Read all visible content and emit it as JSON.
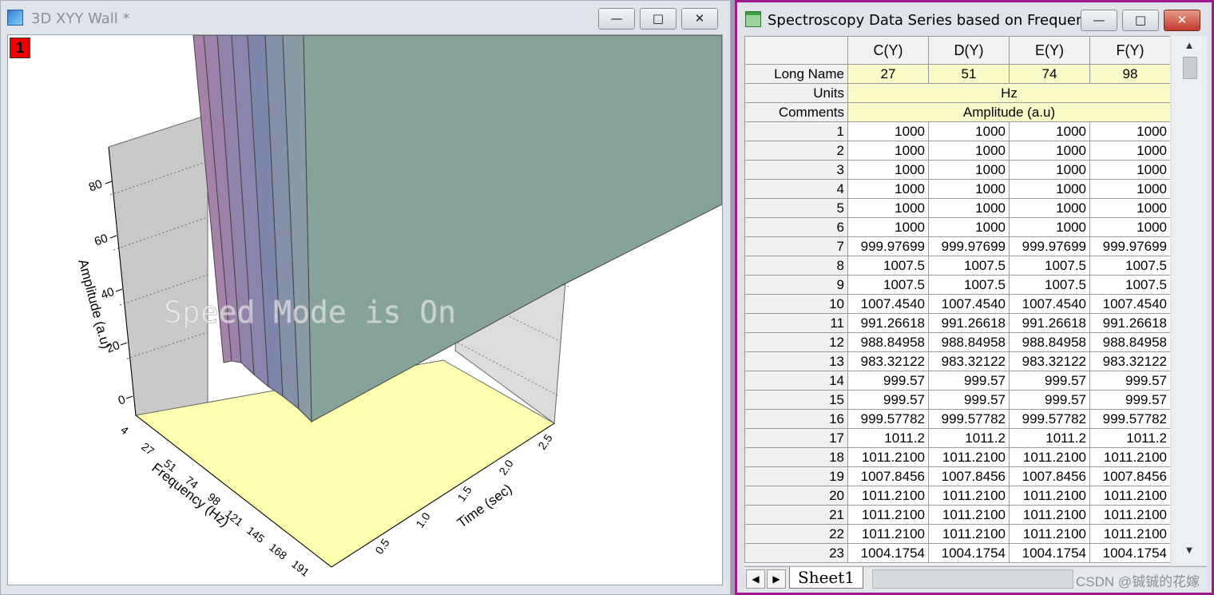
{
  "left_window": {
    "title": "3D XYY Wall *",
    "layer_badge": "1",
    "buttons": {
      "minimize": "—",
      "maximize": "□",
      "close": "✕"
    },
    "watermark": "Speed Mode is On",
    "colors": {
      "backdrop": "#c9c9c9",
      "floor": "#ffffb0",
      "wall_main": "#86a29b",
      "wall_purple": "#9a82a8"
    }
  },
  "chart_data": {
    "type": "3d-wall",
    "title": "",
    "xlabel": "Frequency (Hz)",
    "ylabel": "Time (sec)",
    "zlabel": "Amplitude (a.u)",
    "x_ticks": [
      "4",
      "27",
      "51",
      "74",
      "98",
      "121",
      "145",
      "168",
      "191"
    ],
    "y_ticks": [
      "0.5",
      "1.0",
      "1.5",
      "2.0",
      "2.5"
    ],
    "z_ticks": [
      "0",
      "20",
      "40",
      "60",
      "80"
    ]
  },
  "right_window": {
    "title": "Spectroscopy Data Series based on Frequen...",
    "buttons": {
      "minimize": "—",
      "maximize": "□",
      "close": "✕"
    },
    "columns": [
      "C(Y)",
      "D(Y)",
      "E(Y)",
      "F(Y)"
    ],
    "meta": {
      "long_name_label": "Long Name",
      "long_names": [
        "27",
        "51",
        "74",
        "98"
      ],
      "units_label": "Units",
      "units": "Hz",
      "comments_label": "Comments",
      "comments": "Amplitude (a.u)"
    },
    "rows": [
      {
        "n": "1",
        "v": "1000"
      },
      {
        "n": "2",
        "v": "1000"
      },
      {
        "n": "3",
        "v": "1000"
      },
      {
        "n": "4",
        "v": "1000"
      },
      {
        "n": "5",
        "v": "1000"
      },
      {
        "n": "6",
        "v": "1000"
      },
      {
        "n": "7",
        "v": "999.97699"
      },
      {
        "n": "8",
        "v": "1007.5"
      },
      {
        "n": "9",
        "v": "1007.5"
      },
      {
        "n": "10",
        "v": "1007.4540"
      },
      {
        "n": "11",
        "v": "991.26618"
      },
      {
        "n": "12",
        "v": "988.84958"
      },
      {
        "n": "13",
        "v": "983.32122"
      },
      {
        "n": "14",
        "v": "999.57"
      },
      {
        "n": "15",
        "v": "999.57"
      },
      {
        "n": "16",
        "v": "999.57782"
      },
      {
        "n": "17",
        "v": "1011.2"
      },
      {
        "n": "18",
        "v": "1011.2100"
      },
      {
        "n": "19",
        "v": "1007.8456"
      },
      {
        "n": "20",
        "v": "1011.2100"
      },
      {
        "n": "21",
        "v": "1011.2100"
      },
      {
        "n": "22",
        "v": "1011.2100"
      },
      {
        "n": "23",
        "v": "1004.1754"
      }
    ],
    "sheet_tab": "Sheet1",
    "credit": "CSDN @铖铖的花嫁"
  }
}
